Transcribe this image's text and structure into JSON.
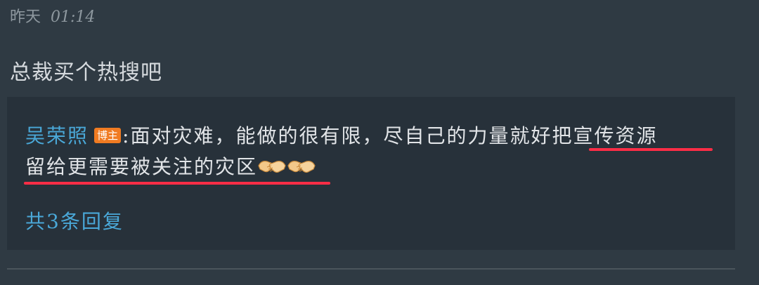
{
  "meta": {
    "date": "昨天",
    "time": "01:14"
  },
  "comment": {
    "text": "总裁买个热搜吧"
  },
  "reply": {
    "author": "吴荣照",
    "badge": "博主",
    "text_line1": ":面对灾难，能做的很有限，尽自己的力量就好把宣传资源",
    "text_line2": "留给更需要被关注的灾区",
    "emojis": [
      "handshake-icon",
      "handshake-icon"
    ],
    "highlight_color": "#ff2d46"
  },
  "replies_link": "共3条回复",
  "colors": {
    "background": "#2f3a43",
    "reply_box": "#27313a",
    "link": "#4aa8d8",
    "badge": "#f07b22"
  }
}
